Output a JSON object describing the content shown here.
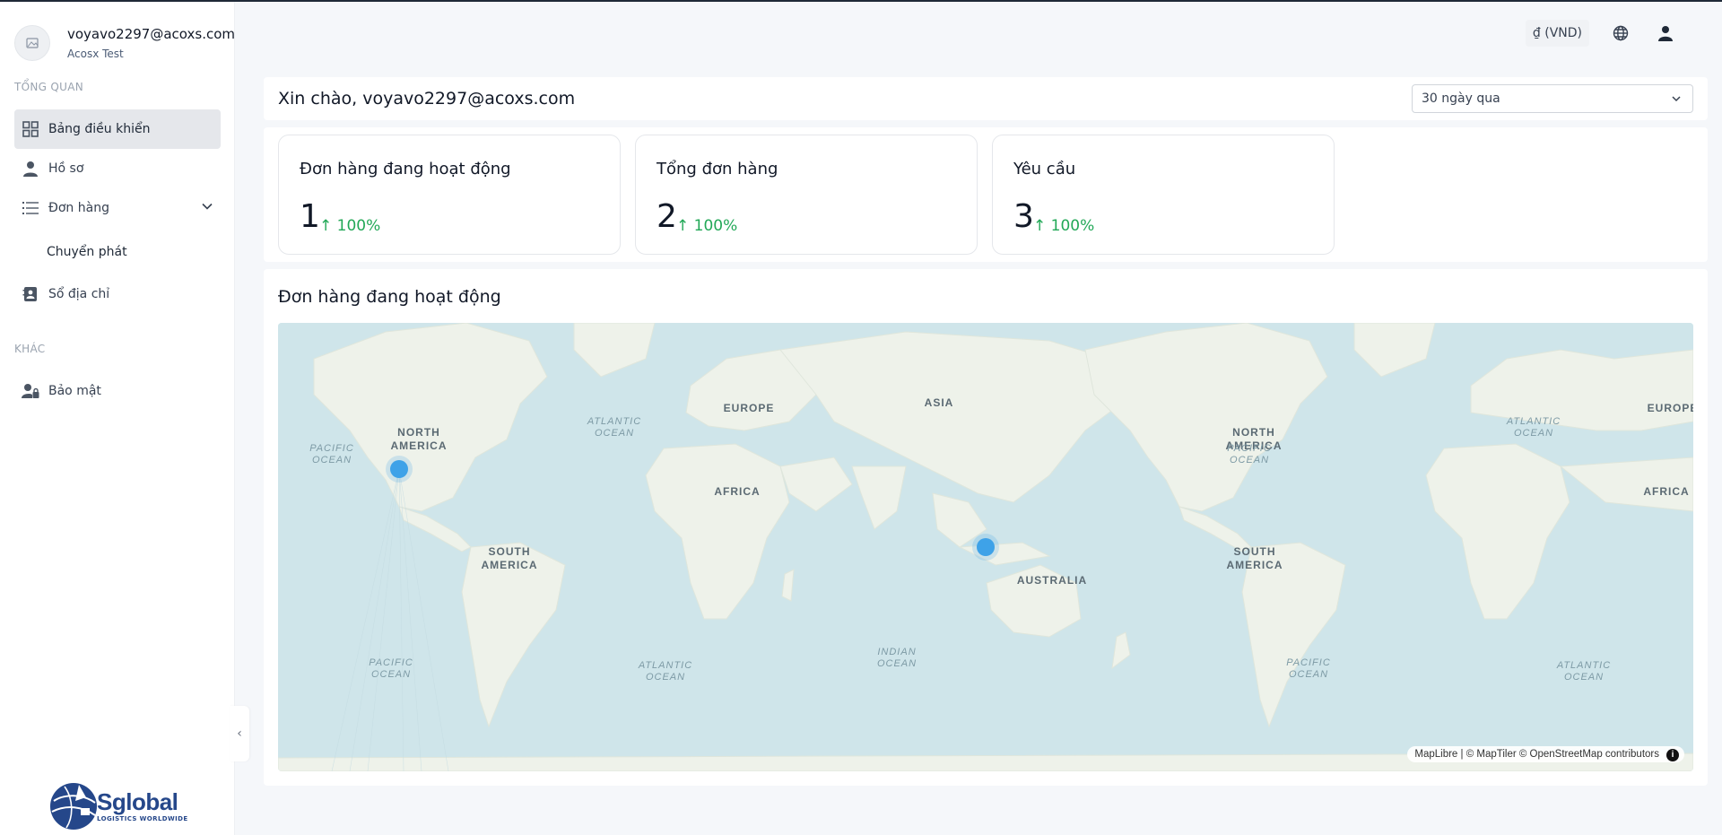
{
  "user": {
    "email": "voyavo2297@acoxs.com",
    "organization": "Acosx Test"
  },
  "sidebar": {
    "section_overview": "TỔNG QUAN",
    "section_other": "KHÁC",
    "items": [
      {
        "label": "Bảng điều khiển",
        "icon": "grid-icon",
        "active": true
      },
      {
        "label": "Hồ sơ",
        "icon": "person-icon"
      },
      {
        "label": "Đơn hàng",
        "icon": "list-icon",
        "expanded": true
      },
      {
        "label": "Chuyển phát",
        "sub": true
      },
      {
        "label": "Sổ địa chỉ",
        "icon": "address-book-icon"
      },
      {
        "label": "Bảo mật",
        "icon": "user-lock-icon"
      }
    ],
    "collapse_icon": "‹"
  },
  "logo": {
    "name": "Sglobal",
    "tagline": "LOGISTICS WORLDWIDE"
  },
  "header": {
    "currency": "₫ (VND)",
    "language_icon": "globe-icon",
    "account_icon": "user-icon"
  },
  "main": {
    "greeting": "Xin chào, voyavo2297@acoxs.com",
    "period": "30 ngày qua",
    "stats": [
      {
        "title": "Đơn hàng đang hoạt động",
        "value": "1",
        "change": "↑ 100%"
      },
      {
        "title": "Tổng đơn hàng",
        "value": "2",
        "change": "↑ 100%"
      },
      {
        "title": "Yêu cầu",
        "value": "3",
        "change": "↑ 100%"
      }
    ],
    "map_title": "Đơn hàng đang hoạt động"
  },
  "map": {
    "labels": {
      "north_america": [
        "NORTH",
        "AMERICA"
      ],
      "north_america_2": [
        "NORTH",
        "AMERICA"
      ],
      "south_america": [
        "SOUTH",
        "AMERICA"
      ],
      "south_america_2": [
        "SOUTH",
        "AMERICA"
      ],
      "europe": "EUROPE",
      "europe_2": "EUROPE",
      "asia": "ASIA",
      "africa": "AFRICA",
      "africa_2": "AFRICA",
      "australia": "AUSTRALIA",
      "pacific_ocean": [
        "PACIFIC",
        "OCEAN"
      ],
      "atlantic_ocean": [
        "ATLANTIC",
        "OCEAN"
      ],
      "indian_ocean": [
        "INDIAN",
        "OCEAN"
      ]
    },
    "attribution": "MapLibre | © MapTiler © OpenStreetMap contributors",
    "colors": {
      "water": "#cfe5ea",
      "land": "#eef2ea",
      "marker": "#3ea2e8"
    }
  }
}
